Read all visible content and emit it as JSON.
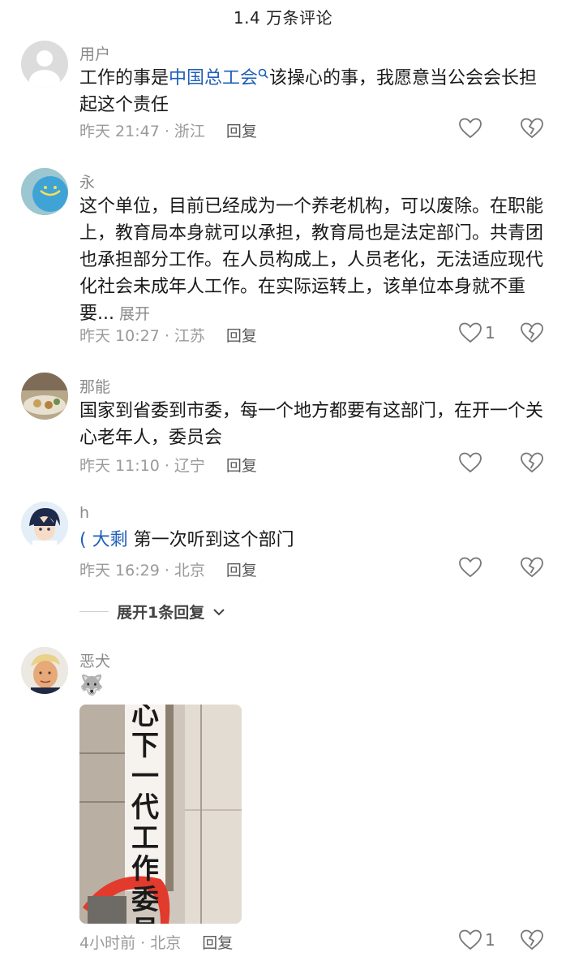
{
  "header": {
    "title": "1.4 万条评论"
  },
  "comments": [
    {
      "username": "用户",
      "text_before": "工作的事是",
      "link": "中国总工会",
      "text_after": "该操心的事，我愿意当公会会长担起这个责任",
      "time": "昨天 21:47 · 浙江",
      "reply": "回复",
      "likes": ""
    },
    {
      "username": "永",
      "text": "这个单位，目前已经成为一个养老机构，可以废除。在职能上，教育局本身就可以承担，教育局也是法定部门。共青团也承担部分工作。在人员构成上，人员老化，无法适应现代化社会未成年人工作。在实际运转上，该单位本身就不重要...",
      "expand": "展开",
      "time": "昨天 10:27 · 江苏",
      "reply": "回复",
      "likes": "1"
    },
    {
      "username": "那能",
      "text": "国家到省委到市委，每一个地方都要有这部门，在开一个关心老年人，委员会",
      "time": "昨天 11:10 · 辽宁",
      "reply": "回复",
      "likes": ""
    },
    {
      "username": "h",
      "link": "(                             大剩",
      "text": " 第一次听到这个部门",
      "time": "昨天 16:29 · 北京",
      "reply": "回复",
      "likes": "",
      "expand_replies": "展开1条回复"
    },
    {
      "username": "恶犬",
      "emoji": "🐺",
      "photo_caption": "心下一代工作委员会",
      "time": "4小时前 · 北京",
      "reply": "回复",
      "likes": "1"
    }
  ],
  "colors": {
    "link": "#1f5fb8",
    "meta": "#9a9a9a",
    "username": "#8a8a8a"
  },
  "icons": {
    "like": "heart-outline-icon",
    "dislike": "broken-heart-icon",
    "expand": "chevron-down-icon"
  }
}
